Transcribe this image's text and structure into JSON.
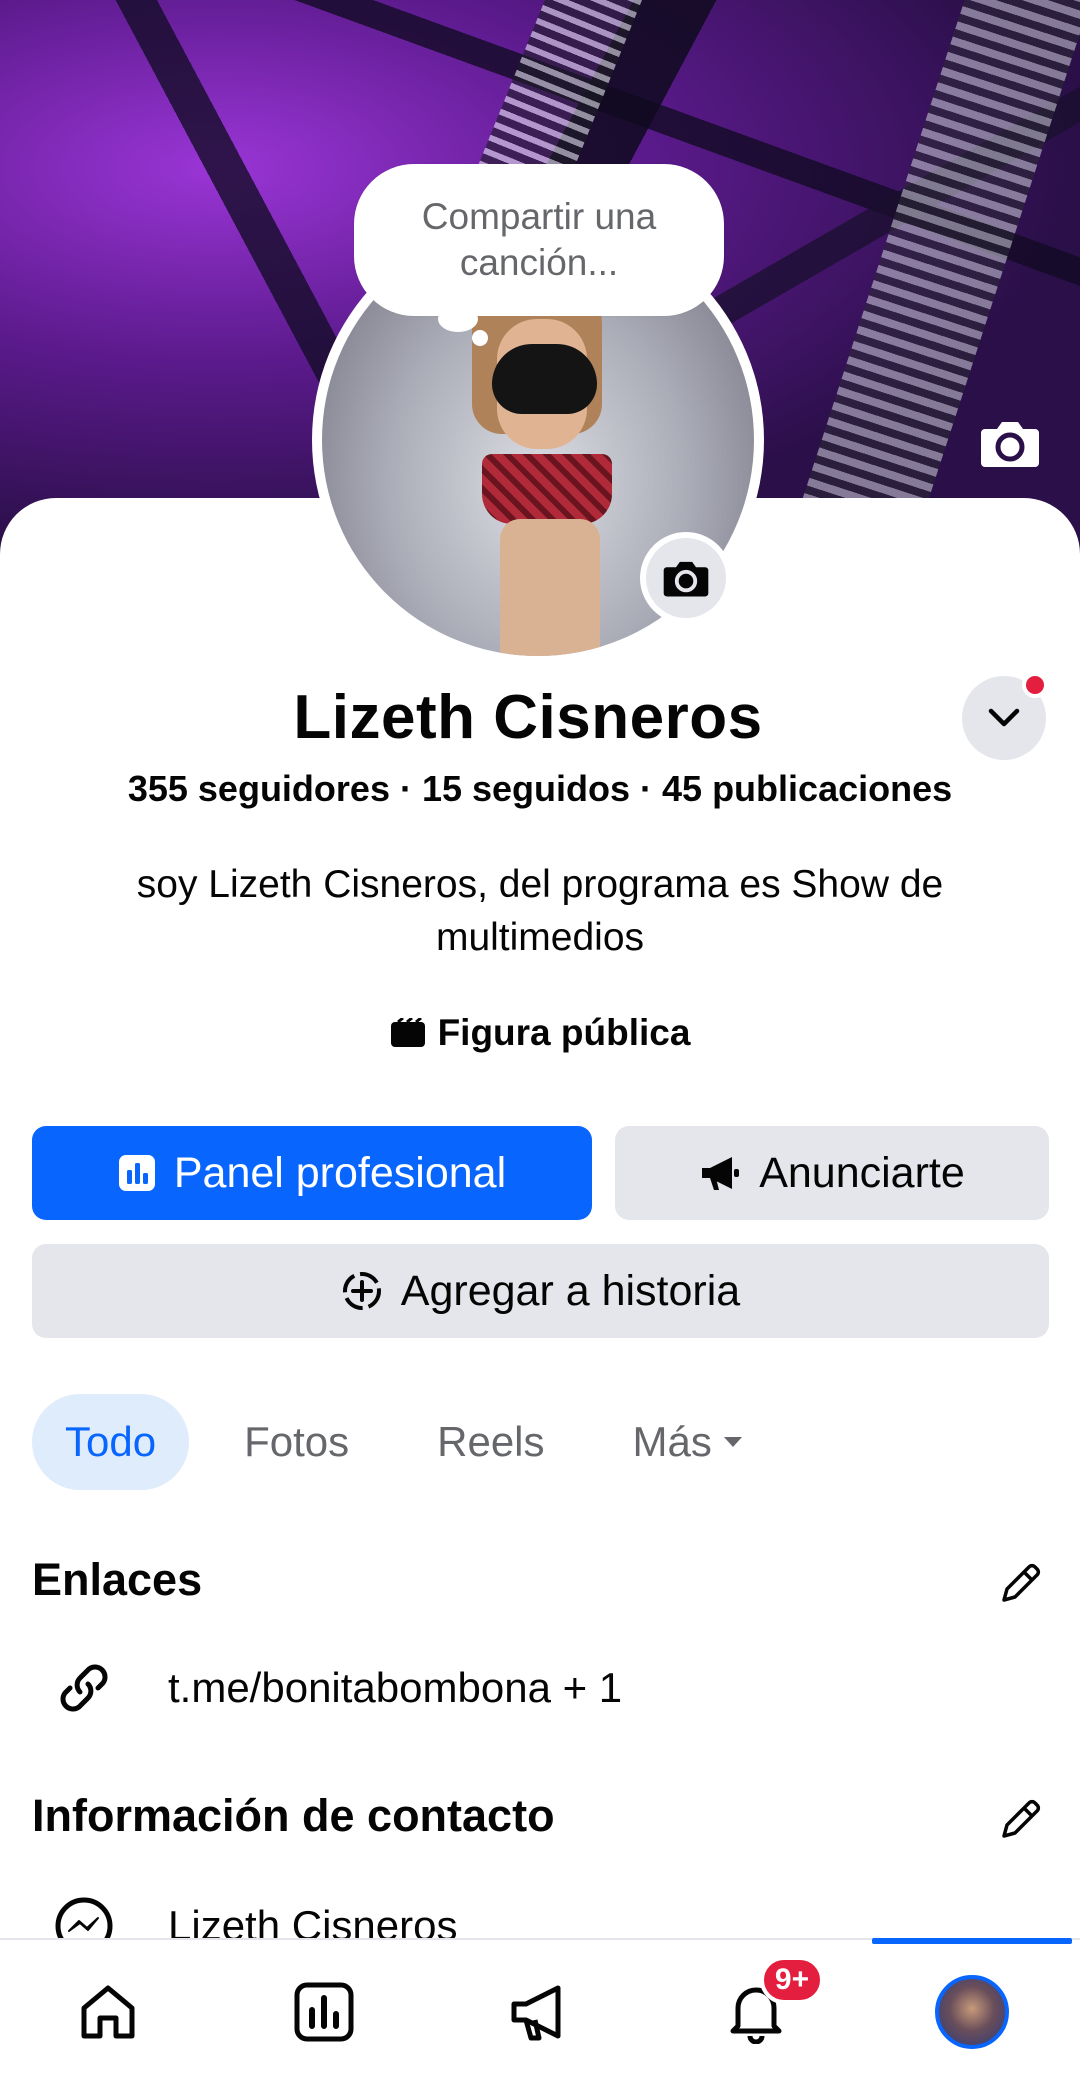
{
  "cover": {
    "camera_icon": "camera-icon"
  },
  "avatar": {
    "camera_icon": "camera-icon"
  },
  "song_bubble": {
    "text": "Compartir una canción..."
  },
  "profile": {
    "name": "Lizeth Cisneros",
    "stats": "355 seguidores · 15 seguidos · 45 publicaciones",
    "bio": "soy Lizeth Cisneros,  del programa es Show de multimedios",
    "category": "Figura pública"
  },
  "buttons": {
    "panel": "Panel profesional",
    "ads": "Anunciarte",
    "story": "Agregar a historia"
  },
  "tabs": [
    {
      "label": "Todo",
      "active": true
    },
    {
      "label": "Fotos",
      "active": false
    },
    {
      "label": "Reels",
      "active": false
    },
    {
      "label": "Más",
      "active": false
    }
  ],
  "links_section": {
    "title": "Enlaces",
    "link": "t.me/bonitabombona + 1"
  },
  "contact_section": {
    "title": "Información de contacto",
    "messenger": "Lizeth Cisneros"
  },
  "bottom_nav": {
    "items": [
      "home-icon",
      "dashboard-icon",
      "megaphone-icon",
      "bell-icon",
      "profile-avatar"
    ],
    "notifications_badge": "9+"
  },
  "colors": {
    "primary": "#0866ff",
    "secondary_button": "#e4e6eb",
    "badge": "#e41e3f",
    "active_tab_bg": "#dfecfb"
  }
}
